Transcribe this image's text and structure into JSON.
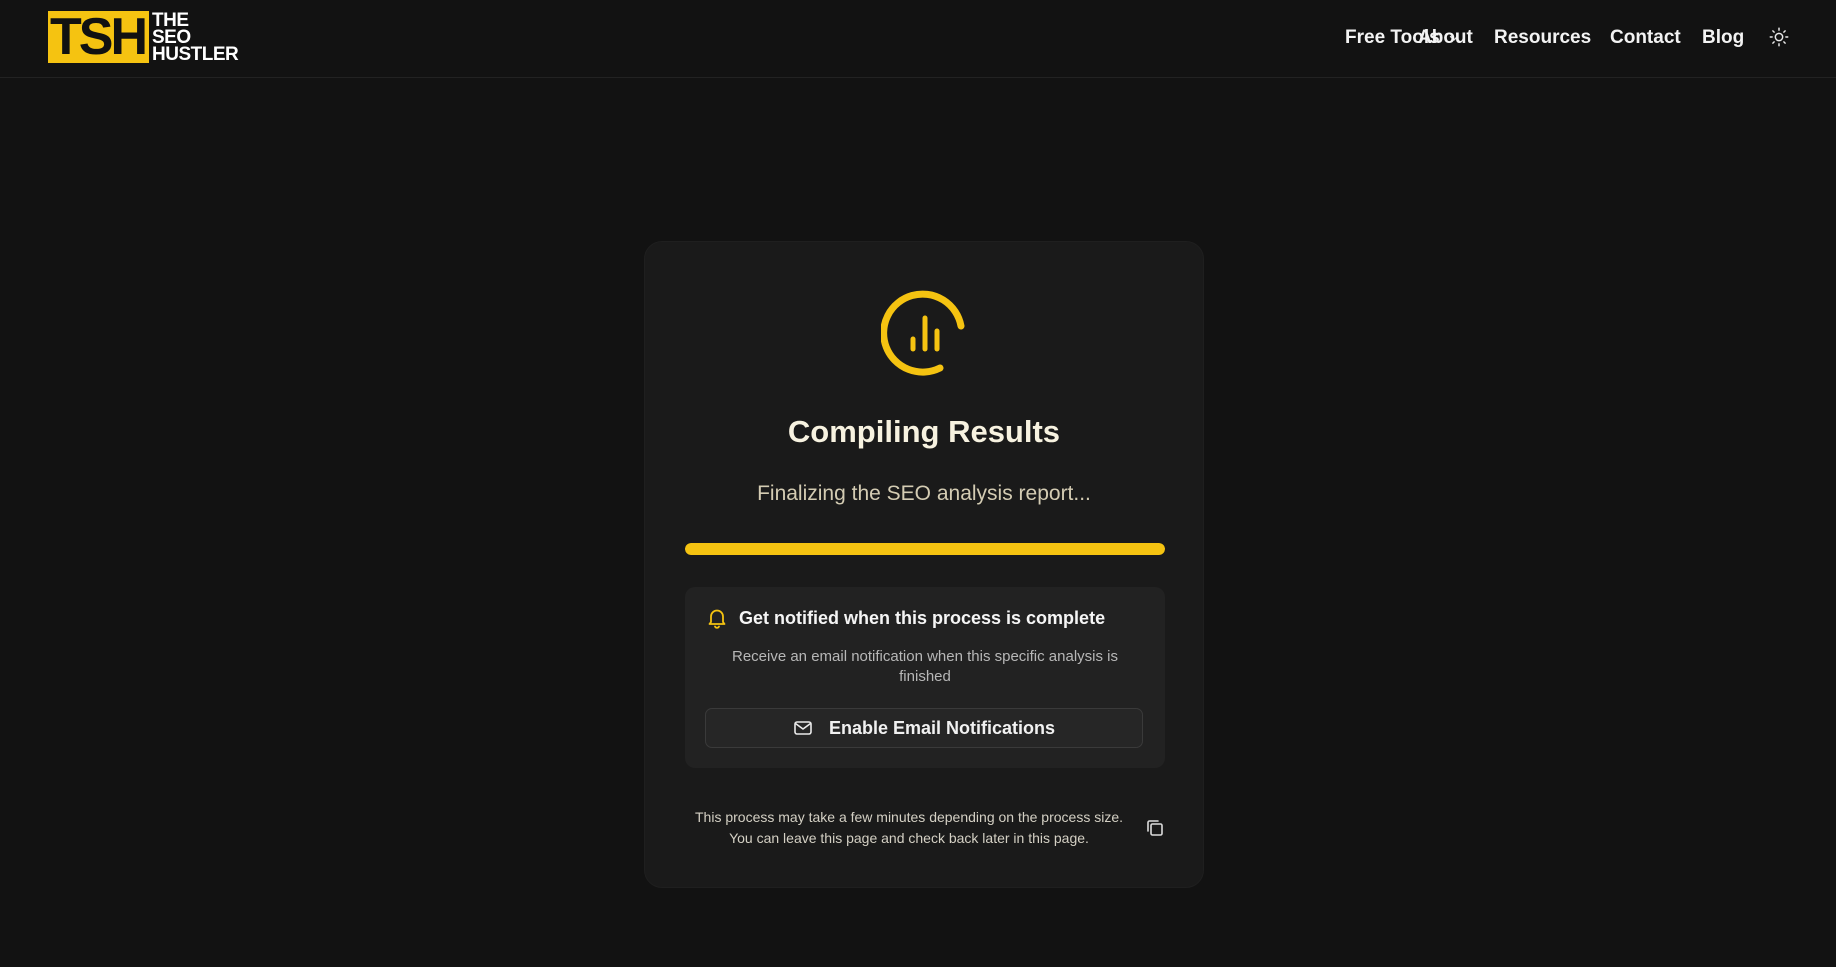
{
  "header": {
    "logo": {
      "mark": "TSH",
      "line1": "THE",
      "line2": "SEO",
      "line3": "HUSTLER"
    },
    "nav": {
      "free_tools": "Free Tools",
      "about": "About",
      "resources": "Resources",
      "contact": "Contact",
      "blog": "Blog"
    },
    "icons": {
      "dropdown": "chevron-down-icon",
      "theme": "sun-icon"
    }
  },
  "card": {
    "status_icon": "chart-spinner-icon",
    "title": "Compiling Results",
    "subtitle": "Finalizing the SEO analysis report...",
    "progress": 1.0,
    "notify": {
      "icon": "bell-icon",
      "title": "Get notified when this process is complete",
      "description": "Receive an email notification when this specific analysis is finished",
      "button_label": "Enable Email Notifications",
      "button_icon": "mail-icon"
    },
    "footnote_line1": "This process may take a few minutes depending on the process size.",
    "footnote_line2": "You can leave this page and check back later in this page.",
    "copy_icon": "copy-icon"
  },
  "colors": {
    "accent": "#f5c311",
    "background": "#121212",
    "card": "#1a1a1a"
  }
}
